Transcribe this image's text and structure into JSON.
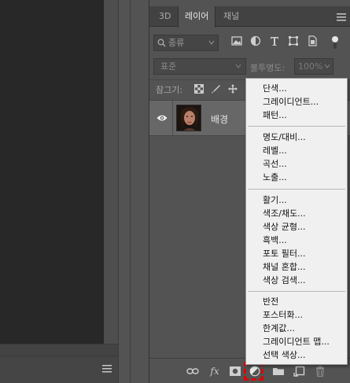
{
  "panel": {
    "tabs": [
      {
        "label": "3D",
        "active": false
      },
      {
        "label": "레이어",
        "active": true
      },
      {
        "label": "채널",
        "active": false
      }
    ],
    "filter": {
      "kind_label": "종류"
    },
    "blend_mode": "표준",
    "opacity_label": "불투명도:",
    "opacity_value": "100%",
    "lock_label": "잠그기:",
    "layers": [
      {
        "name": "배경",
        "visible": true
      }
    ],
    "bottom_icons": [
      "link-icon",
      "fx-icon",
      "mask-icon",
      "adjustment-icon",
      "folder-icon",
      "new-layer-icon",
      "trash-icon"
    ],
    "fx_label": "fx"
  },
  "menu": {
    "groups": [
      [
        "단색...",
        "그레이디언트...",
        "패턴..."
      ],
      [
        "명도/대비...",
        "레벨...",
        "곡선...",
        "노출..."
      ],
      [
        "활기...",
        "색조/채도...",
        "색상 균형...",
        "흑백...",
        "포토 필터...",
        "채널 혼합...",
        "색상 검색..."
      ],
      [
        "반전",
        "포스터화...",
        "한계값...",
        "그레이디언트 맵...",
        "선택 색상..."
      ]
    ]
  },
  "colors": {
    "highlight_border": "#e00000",
    "panel_bg": "#535353",
    "menu_bg": "#f0f0f0"
  }
}
